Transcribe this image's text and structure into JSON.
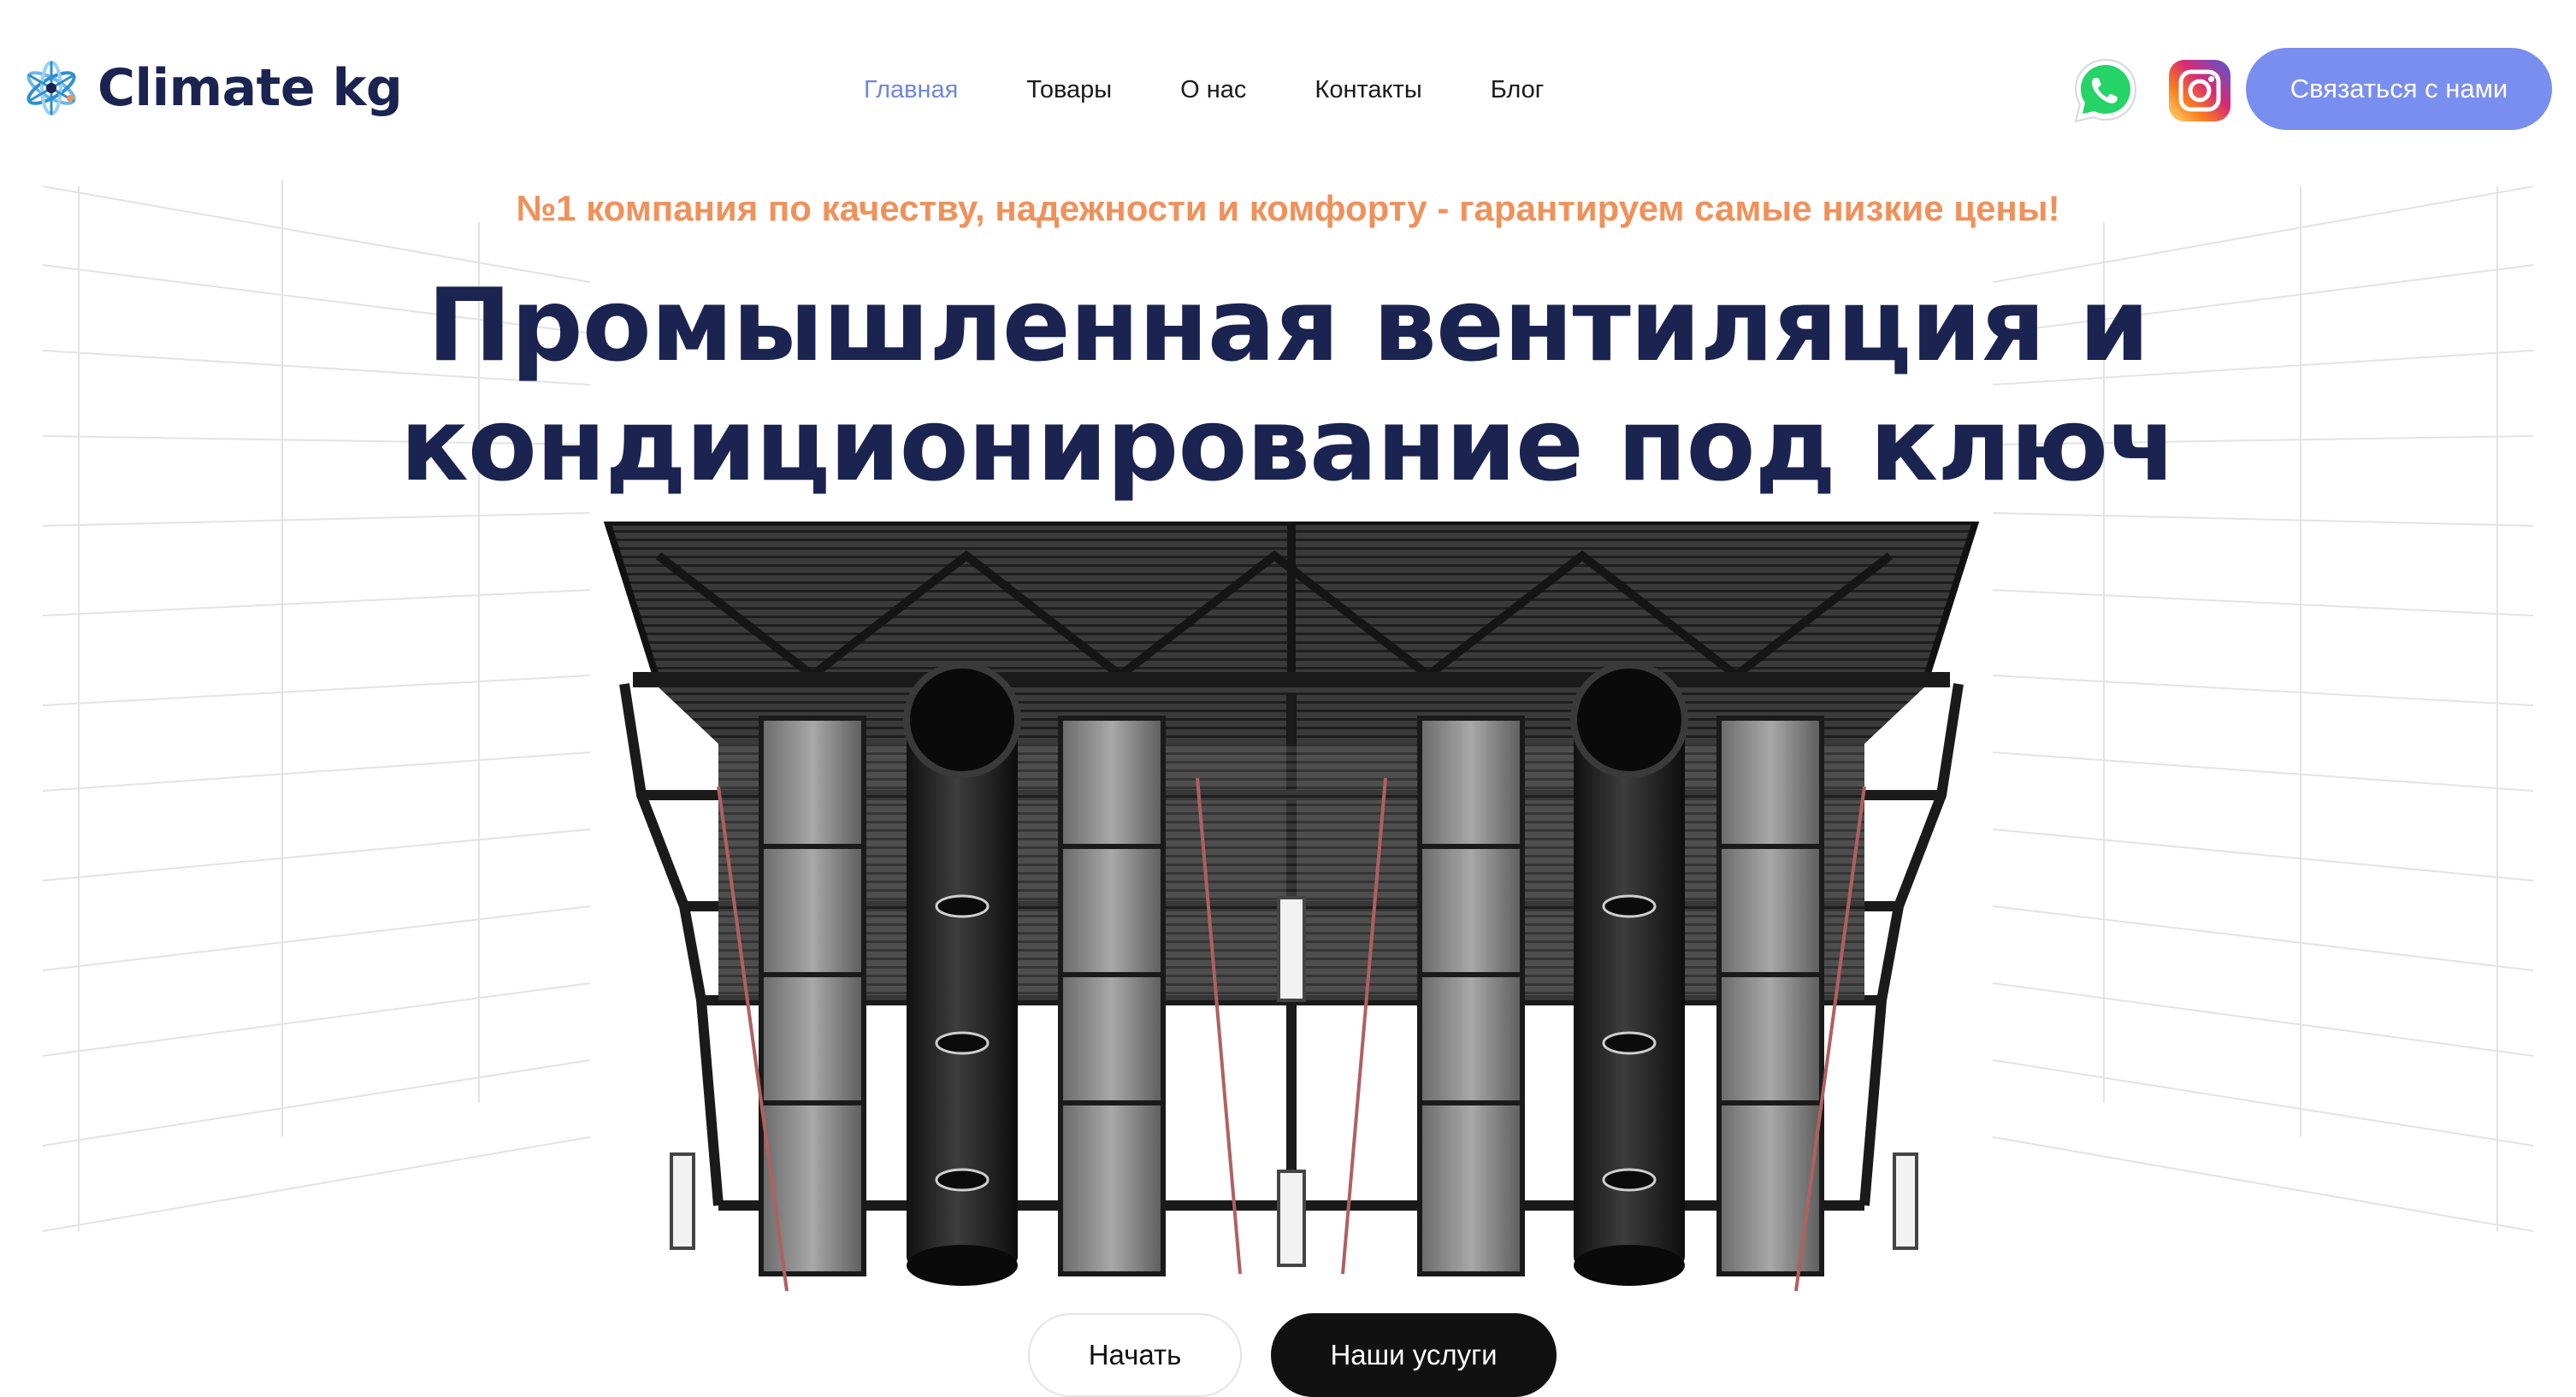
{
  "header": {
    "logo_text": "Climate kg",
    "logo_icon": "snowflake-atom-icon",
    "nav": [
      {
        "label": "Главная",
        "active": true
      },
      {
        "label": "Товары",
        "active": false
      },
      {
        "label": "О нас",
        "active": false
      },
      {
        "label": "Контакты",
        "active": false
      },
      {
        "label": "Блог",
        "active": false
      }
    ],
    "social": [
      {
        "icon": "whatsapp-icon",
        "color": "#25d366"
      },
      {
        "icon": "instagram-icon",
        "color": "#d62976"
      }
    ],
    "contact_button": "Связаться с нами"
  },
  "hero": {
    "tagline": "№1 компания по качеству, надежности и комфорту - гарантируем самые низкие цены!",
    "title_line1": "Промышленная вентиляция и",
    "title_line2": "кондиционирование под ключ",
    "image": "industrial-ventilation-ducts-illustration",
    "start_button": "Начать",
    "services_button": "Наши услуги"
  },
  "colors": {
    "accent": "#7a8eef",
    "nav_active": "#6f87d9",
    "tagline": "#f0915a",
    "title": "#1b2450",
    "dark_button": "#111111"
  }
}
